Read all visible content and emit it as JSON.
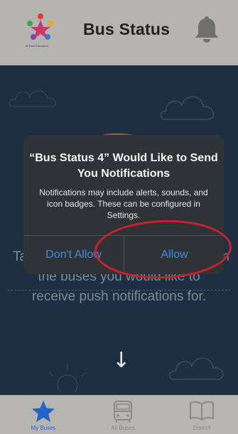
{
  "header": {
    "title": "Bus Status",
    "logo_text": "Al Real Education"
  },
  "alert": {
    "title": "“Bus Status 4” Would Like to Send You Notifications",
    "message": "Notifications may include alerts, sounds, and icon badges. These can be configured in Settings.",
    "dont_allow_label": "Don't Allow",
    "allow_label": "Allow"
  },
  "background": {
    "instruction_left": "Ta",
    "instruction_right": "n",
    "instruction_line2": "the buses you would like to",
    "instruction_line3": "receive push notifications for.",
    "arrow": "↓"
  },
  "tabbar": {
    "tabs": [
      {
        "label": "My Buses",
        "icon": "star-icon",
        "active": true
      },
      {
        "label": "All Buses",
        "icon": "bus-icon",
        "active": false
      },
      {
        "label": "District",
        "icon": "book-icon",
        "active": false
      }
    ]
  },
  "colors": {
    "accent": "#2364c6",
    "alert_button": "#3d8be0",
    "annotation": "#c9212b",
    "screen_bg": "#1d2f40"
  }
}
